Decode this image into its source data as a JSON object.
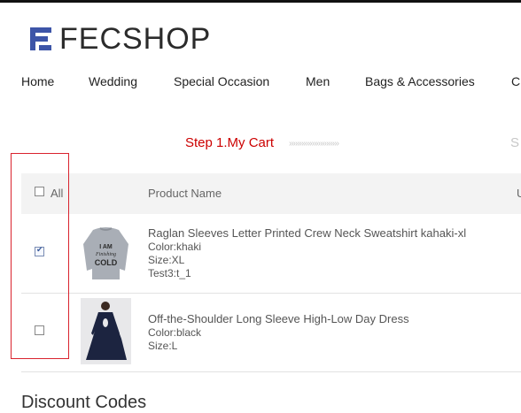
{
  "brand": {
    "logo_text": "FECSHOP",
    "accent": "#3d55a8"
  },
  "nav": [
    "Home",
    "Wedding",
    "Special Occasion",
    "Men",
    "Bags & Accessories",
    "C"
  ],
  "steps": {
    "current": "Step 1.My Cart",
    "arrows": "››››››››››››››››››››››››",
    "next": "S"
  },
  "table": {
    "select_all_label": "All",
    "columns": [
      "Product Name",
      "U"
    ]
  },
  "cart_items": [
    {
      "checked": true,
      "name": "Raglan Sleeves Letter Printed Crew Neck Sweatshirt kahaki-xl",
      "attributes": [
        "Color:khaki",
        "Size:XL",
        "Test3:t_1"
      ],
      "thumb_text": [
        "I AM",
        "Finishing",
        "COLD"
      ]
    },
    {
      "checked": false,
      "name": "Off-the-Shoulder Long Sleeve High-Low Day Dress",
      "attributes": [
        "Color:black",
        "Size:L"
      ]
    }
  ],
  "discount_heading": "Discount Codes",
  "colors": {
    "step_current": "#cc0000",
    "highlight_border": "#d9232e",
    "header_bg": "#f3f3f3"
  }
}
